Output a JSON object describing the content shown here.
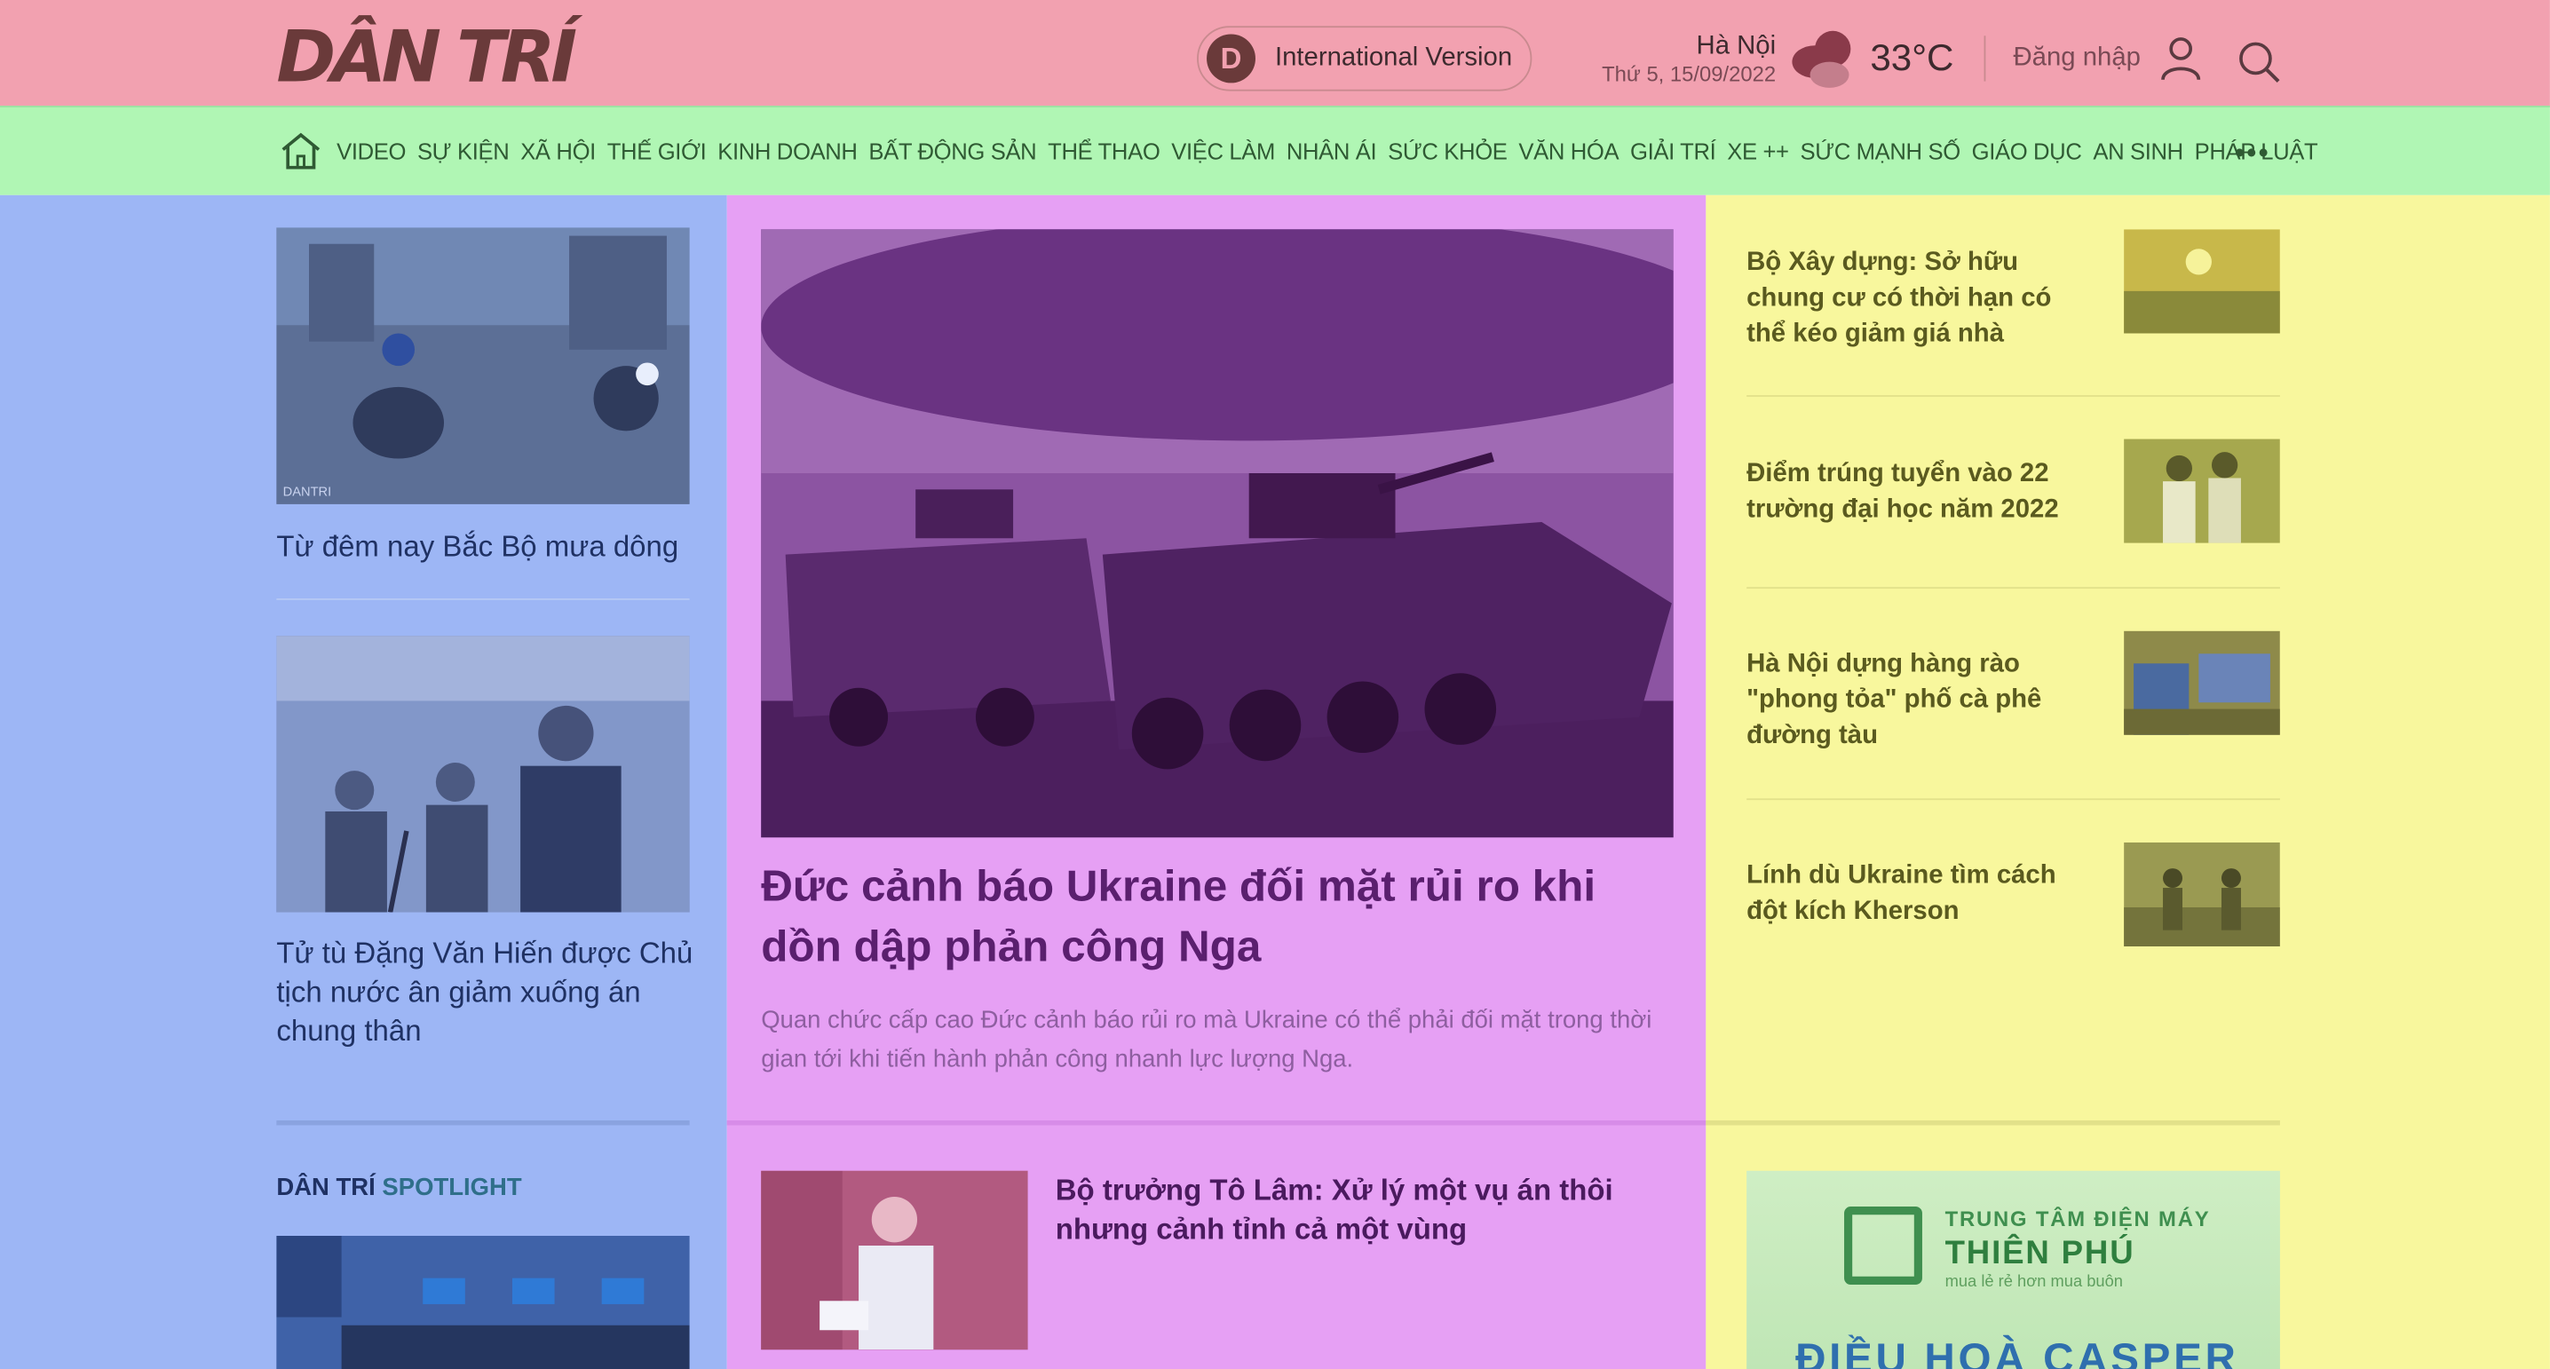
{
  "header": {
    "logo": "DÂN TRÍ",
    "international_badge": "D",
    "international_label": "International Version",
    "city": "Hà Nội",
    "date": "Thứ 5, 15/09/2022",
    "temperature": "33°C",
    "login_label": "Đăng nhập",
    "icons": [
      "weather-cloudy-icon",
      "user-icon",
      "search-icon"
    ]
  },
  "nav": {
    "items": [
      "VIDEO",
      "SỰ KIỆN",
      "XÃ HỘI",
      "THẾ GIỚI",
      "KINH DOANH",
      "BẤT ĐỘNG SẢN",
      "THỂ THAO",
      "VIỆC LÀM",
      "NHÂN ÁI",
      "SỨC KHỎE",
      "VĂN HÓA",
      "GIẢI TRÍ",
      "XE ++",
      "SỨC MẠNH SỐ",
      "GIÁO DỤC",
      "AN SINH",
      "PHÁP LUẬT"
    ],
    "more": "•••"
  },
  "left": {
    "story1": "Từ đêm nay Bắc Bộ mưa dông",
    "story2": "Tử tù Đặng Văn Hiến được Chủ tịch nước ân giảm xuống án chung thân",
    "spotlight_prefix": "DÂN TRÍ",
    "spotlight_suffix": "SPOTLIGHT",
    "thumb_watermark": "DANTRI"
  },
  "main": {
    "headline": "Đức cảnh báo Ukraine đối mặt rủi ro khi dồn dập phản công Nga",
    "summary": "Quan chức cấp cao Đức cảnh báo rủi ro mà Ukraine có thể phải đối mặt trong thời gian tới khi tiến hành phản công nhanh lực lượng Nga.",
    "story2": "Bộ trưởng Tô Lâm: Xử lý một vụ án thôi nhưng cảnh tỉnh cả một vùng"
  },
  "right": {
    "items": [
      "Bộ Xây dựng: Sở hữu chung cư có thời hạn có thể kéo giảm giá nhà",
      "Điểm trúng tuyển vào 22 trường đại học năm 2022",
      "Hà Nội dựng hàng rào \"phong tỏa\" phố cà phê đường tàu",
      "Lính dù Ukraine tìm cách đột kích Kherson"
    ],
    "ad": {
      "line1": "TRUNG TÂM ĐIỆN MÁY",
      "line2": "THIÊN PHÚ",
      "line3": "mua lẻ rẻ hơn mua buôn",
      "line4": "ĐIỀU HOÀ CASPER"
    }
  },
  "colors": {
    "header_bg": "#f2a1b0",
    "nav_bg": "#b0f6b4",
    "left_bg": "#9db6f5",
    "main_bg": "#e6a0f4",
    "right_bg": "#f8f79d"
  }
}
